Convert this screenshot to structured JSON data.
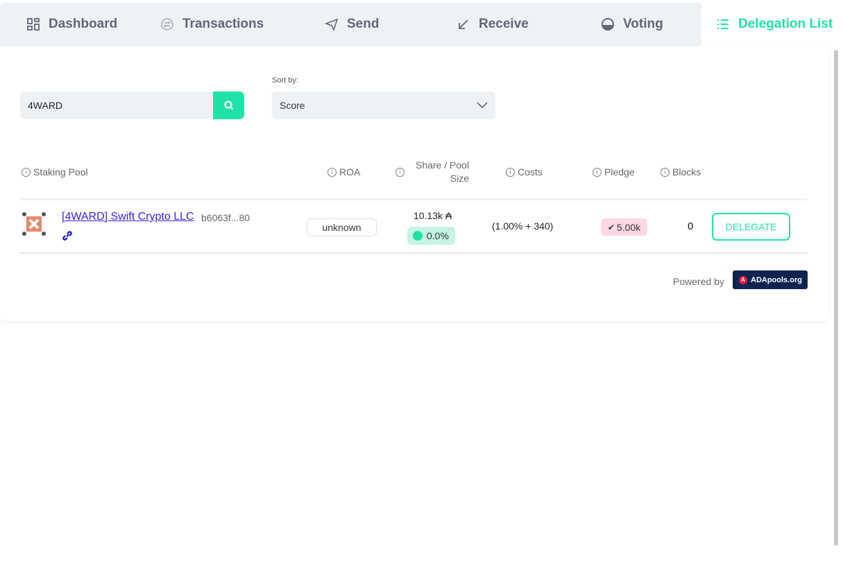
{
  "tabs": [
    {
      "label": "Dashboard",
      "icon": "grid-icon"
    },
    {
      "label": "Transactions",
      "icon": "exchange-icon"
    },
    {
      "label": "Send",
      "icon": "paper-plane-icon"
    },
    {
      "label": "Receive",
      "icon": "arrow-down-left-icon"
    },
    {
      "label": "Voting",
      "icon": "voting-icon"
    },
    {
      "label": "Delegation List",
      "icon": "list-icon",
      "active": true
    }
  ],
  "search": {
    "value": "4WARD"
  },
  "sort": {
    "label": "Sort by:",
    "value": "Score"
  },
  "columns": {
    "pool": "Staking Pool",
    "roa": "ROA",
    "share1": "Share / Pool",
    "share2": "Size",
    "costs": "Costs",
    "pledge": "Pledge",
    "blocks": "Blocks"
  },
  "pools": [
    {
      "name": "[4WARD] Swift Crypto LLC",
      "id": "b6063f...80",
      "roa": "unknown",
      "size": "10.13k ₳",
      "share": "0.0%",
      "costs": "(1.00% + 340)",
      "pledge": "5.00k",
      "blocks": "0",
      "action": "DELEGATE"
    }
  ],
  "footer": {
    "powered": "Powered by",
    "brand": "ADApools.org"
  },
  "colors": {
    "accent": "#1ee3a8",
    "brand": "#0d2451"
  }
}
